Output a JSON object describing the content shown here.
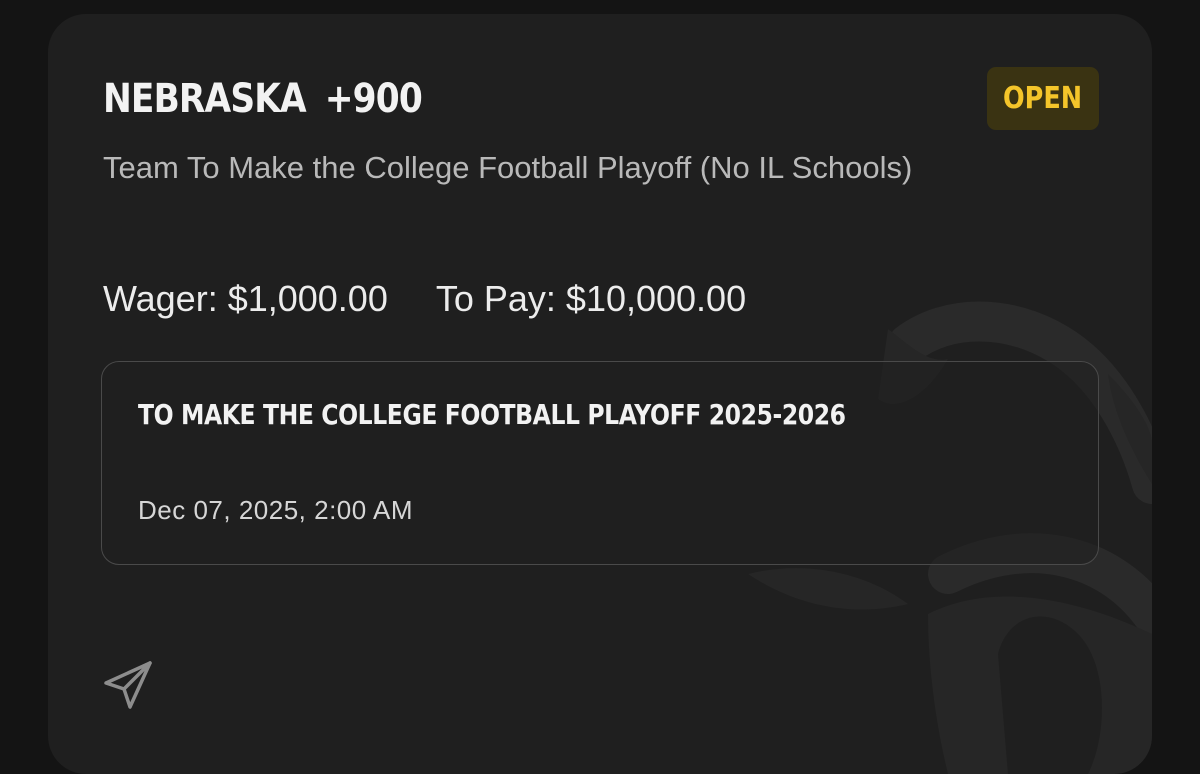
{
  "bet": {
    "team": "NEBRASKA",
    "odds": "+900",
    "status": "OPEN",
    "market": "Team To Make the College Football Playoff (No IL Schools)",
    "wager_text": "Wager: $1,000.00",
    "to_pay_text": "To Pay: $10,000.00"
  },
  "event": {
    "title": "TO MAKE THE COLLEGE FOOTBALL PLAYOFF 2025-2026",
    "date": "Dec 07, 2025, 2:00 AM"
  },
  "icons": {
    "share": "send-icon",
    "watermark": "brand-watermark-logo"
  },
  "colors": {
    "card_background": "#1f1f1f",
    "page_background": "#141414",
    "status_text": "#f4c52a",
    "status_background": "#3a3312"
  }
}
